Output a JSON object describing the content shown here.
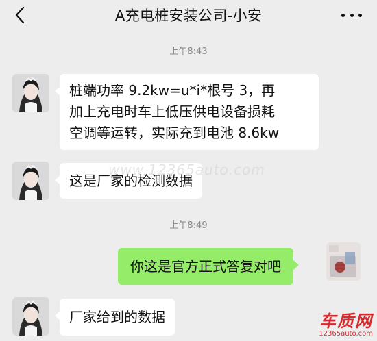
{
  "header": {
    "title": "A充电桩安装公司-小安",
    "back_icon": "chevron-left-icon",
    "more_icon": "ellipsis-icon"
  },
  "messages": [
    {
      "timestamp": "上午8:43"
    },
    {
      "side": "left",
      "lines": [
        "桩端功率 9.2kw=u*i*根号 3，再",
        "加上充电时车上低压供电设备损耗",
        "空调等运转，实际充到电池 8.6kw"
      ]
    },
    {
      "side": "left",
      "text": "这是厂家的检测数据"
    },
    {
      "timestamp": "上午8:49"
    },
    {
      "side": "right",
      "text": "你这是官方正式答复对吧"
    },
    {
      "side": "left",
      "text": "厂家给到的数据"
    }
  ],
  "watermark": {
    "center": "www.12365auto.com",
    "logo": "车质网",
    "url": "12365auto.com"
  },
  "colors": {
    "background": "#ededed",
    "bubble_left": "#ffffff",
    "bubble_right": "#95ec69",
    "watermark": "#d8292f"
  }
}
